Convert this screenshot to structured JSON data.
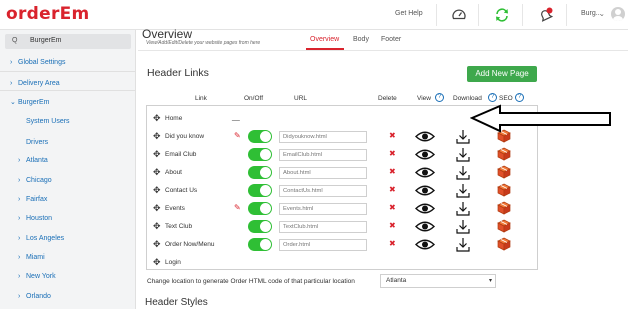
{
  "app": {
    "logo": "orderEm"
  },
  "topbar": {
    "help": "Get Help",
    "user": "Burg...",
    "chevron": "⌄"
  },
  "sidebar": {
    "search_icon_glyph": "Q",
    "search_value": "BurgerEm",
    "items": [
      {
        "label": "Global Settings",
        "arrow": "›"
      },
      {
        "label": "Delivery Area",
        "arrow": "›"
      },
      {
        "label": "BurgerEm",
        "arrow": "⌄"
      },
      {
        "label": "System Users",
        "arrow": ""
      },
      {
        "label": "Drivers",
        "arrow": ""
      },
      {
        "label": "Atlanta",
        "arrow": "›"
      },
      {
        "label": "Chicago",
        "arrow": "›"
      },
      {
        "label": "Fairfax",
        "arrow": "›"
      },
      {
        "label": "Houston",
        "arrow": "›"
      },
      {
        "label": "Los Angeles",
        "arrow": "›"
      },
      {
        "label": "Miami",
        "arrow": "›"
      },
      {
        "label": "New York",
        "arrow": "›"
      },
      {
        "label": "Orlando",
        "arrow": "›"
      }
    ]
  },
  "main": {
    "title": "Overview",
    "subtitle": "View/Add/Edit/Delete your website pages from here",
    "tabs": [
      "Overview",
      "Body",
      "Footer"
    ],
    "active_tab": "Overview"
  },
  "header_links": {
    "title": "Header Links",
    "add_button": "Add New Page",
    "columns": {
      "link": "Link",
      "onoff": "On/Off",
      "url": "URL",
      "delete": "Delete",
      "view": "View",
      "download": "Download",
      "seo": "SEO"
    },
    "help_glyph": "?",
    "move_glyph": "✥",
    "pencil_glyph": "✎",
    "delete_glyph": "✖",
    "dash": "__",
    "rows": [
      {
        "label": "Home",
        "editable": false,
        "toggle": false,
        "url": "",
        "actions": false
      },
      {
        "label": "Did you know",
        "editable": true,
        "toggle": true,
        "url": "Didyouknow.html",
        "actions": true
      },
      {
        "label": "Email Club",
        "editable": false,
        "toggle": true,
        "url": "EmailClub.html",
        "actions": true
      },
      {
        "label": "About",
        "editable": false,
        "toggle": true,
        "url": "About.html",
        "actions": true
      },
      {
        "label": "Contact Us",
        "editable": false,
        "toggle": true,
        "url": "ContactUs.html",
        "actions": true
      },
      {
        "label": "Events",
        "editable": true,
        "toggle": true,
        "url": "Events.html",
        "actions": true
      },
      {
        "label": "Text Club",
        "editable": false,
        "toggle": true,
        "url": "TextClub.html",
        "actions": true
      },
      {
        "label": "Order Now/Menu",
        "editable": false,
        "toggle": true,
        "url": "Order.html",
        "actions": true
      },
      {
        "label": "Login",
        "editable": false,
        "toggle": false,
        "url": "",
        "actions": false
      }
    ]
  },
  "location": {
    "label": "Change location to generate Order HTML code of that particular location",
    "selected": "Atlanta",
    "caret": "▾"
  },
  "header_styles": {
    "title": "Header Styles"
  },
  "colors": {
    "brand_red": "#d9232d",
    "green": "#3ea84c",
    "toggle_green": "#2fbf35",
    "link_blue": "#1a6fb7"
  }
}
